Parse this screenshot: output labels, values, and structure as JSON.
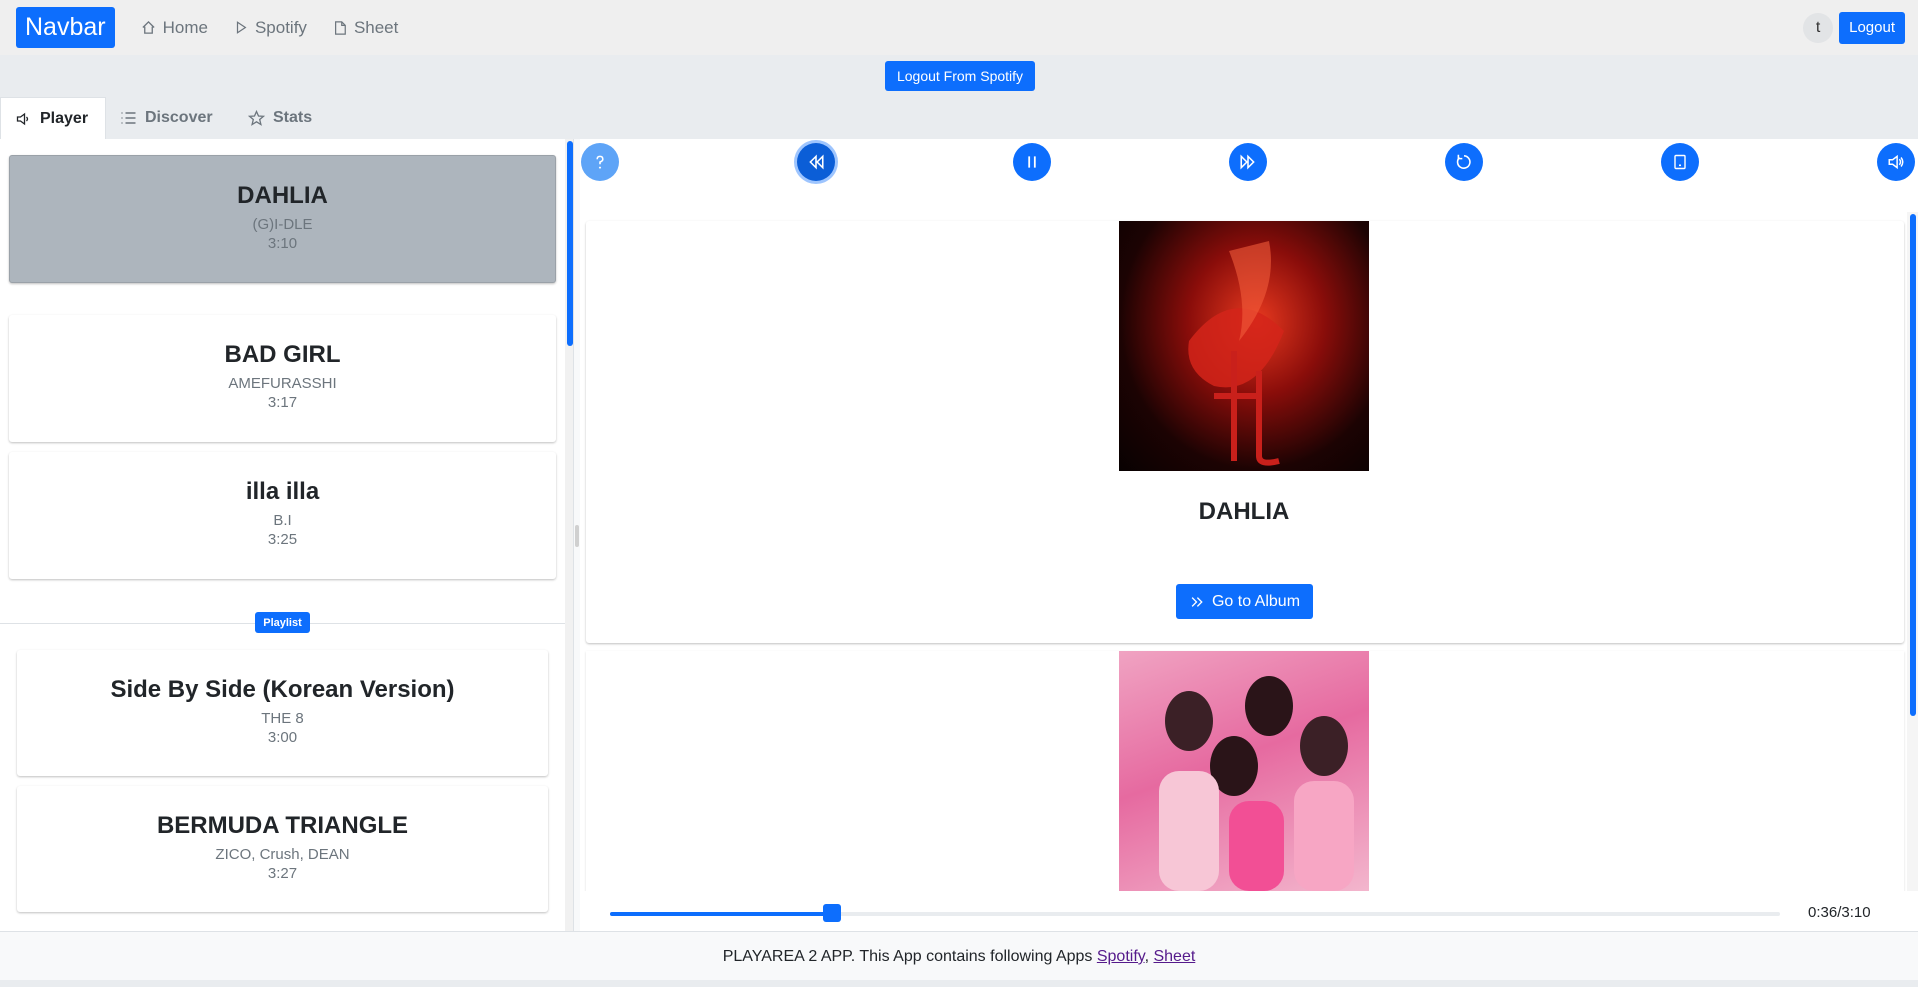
{
  "navbar": {
    "brand": "Navbar",
    "links": [
      {
        "label": "Home",
        "icon": "home-icon"
      },
      {
        "label": "Spotify",
        "icon": "play-icon"
      },
      {
        "label": "Sheet",
        "icon": "file-icon"
      }
    ],
    "avatar_initial": "t",
    "logout_label": "Logout"
  },
  "spotify": {
    "logout_label": "Logout From Spotify"
  },
  "tabs": [
    {
      "label": "Player",
      "icon": "speaker-icon",
      "active": true
    },
    {
      "label": "Discover",
      "icon": "list-icon",
      "active": false
    },
    {
      "label": "Stats",
      "icon": "star-icon",
      "active": false
    }
  ],
  "queue": [
    {
      "title": "DAHLIA",
      "artist": "(G)I-DLE",
      "duration": "3:10",
      "selected": true
    },
    {
      "title": "BAD GIRL",
      "artist": "AMEFURASSHI",
      "duration": "3:17"
    },
    {
      "title": "illa illa",
      "artist": "B.I",
      "duration": "3:25"
    }
  ],
  "playlist": {
    "badge": "Playlist",
    "items": [
      {
        "title": "Side By Side (Korean Version)",
        "artist": "THE 8",
        "duration": "3:00"
      },
      {
        "title": "BERMUDA TRIANGLE",
        "artist": "ZICO, Crush, DEAN",
        "duration": "3:27"
      }
    ]
  },
  "player": {
    "controls": [
      "help-icon",
      "rewind-icon",
      "pause-icon",
      "fast-forward-icon",
      "repeat-icon",
      "device-icon",
      "volume-icon"
    ],
    "album_title": "DAHLIA",
    "go_to_album_label": "Go to Album",
    "progress": 0.19,
    "time_readout": "0:36/3:10"
  },
  "footer": {
    "text": "PLAYAREA 2 APP. This App contains following Apps ",
    "link1": "Spotify",
    "separator": ", ",
    "link2": "Sheet"
  },
  "colors": {
    "primary": "#0d6efd",
    "selected_card": "#adb5bd",
    "navbar_bg": "#efefef"
  }
}
